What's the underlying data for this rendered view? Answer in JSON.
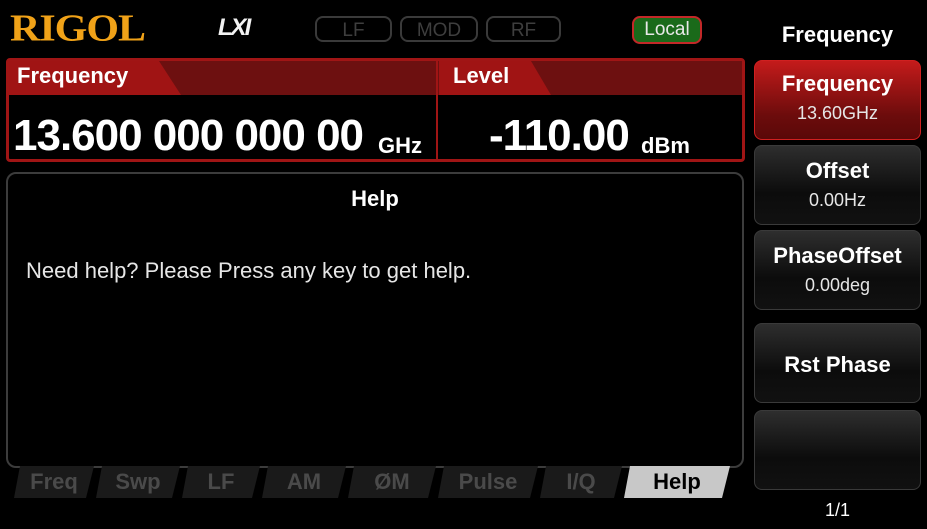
{
  "header": {
    "logo": "RIGOL",
    "lxi": "LXI",
    "indicators": {
      "lf": "LF",
      "mod": "MOD",
      "rf": "RF"
    },
    "local": "Local"
  },
  "frequency_panel": {
    "freq_title": "Frequency",
    "freq_value": "13.600 000 000 00",
    "freq_unit": "GHz",
    "level_title": "Level",
    "level_value": "-110.00",
    "level_unit": "dBm"
  },
  "help_panel": {
    "title": "Help",
    "text": "Need help? Please Press any key to get help."
  },
  "tabs": [
    "Freq",
    "Swp",
    "LF",
    "AM",
    "ØM",
    "Pulse",
    "I/Q",
    "Help"
  ],
  "menu": {
    "title": "Frequency",
    "buttons": [
      {
        "label": "Frequency",
        "value": "13.60GHz"
      },
      {
        "label": "Offset",
        "value": "0.00Hz"
      },
      {
        "label": "PhaseOffset",
        "value": "0.00deg"
      },
      {
        "label": "Rst Phase",
        "value": ""
      },
      {
        "label": "",
        "value": ""
      }
    ],
    "page": "1/1"
  },
  "colors": {
    "logo": "#f0a218",
    "accent_red": "#a01515",
    "local_bg": "#1a6a1a"
  }
}
